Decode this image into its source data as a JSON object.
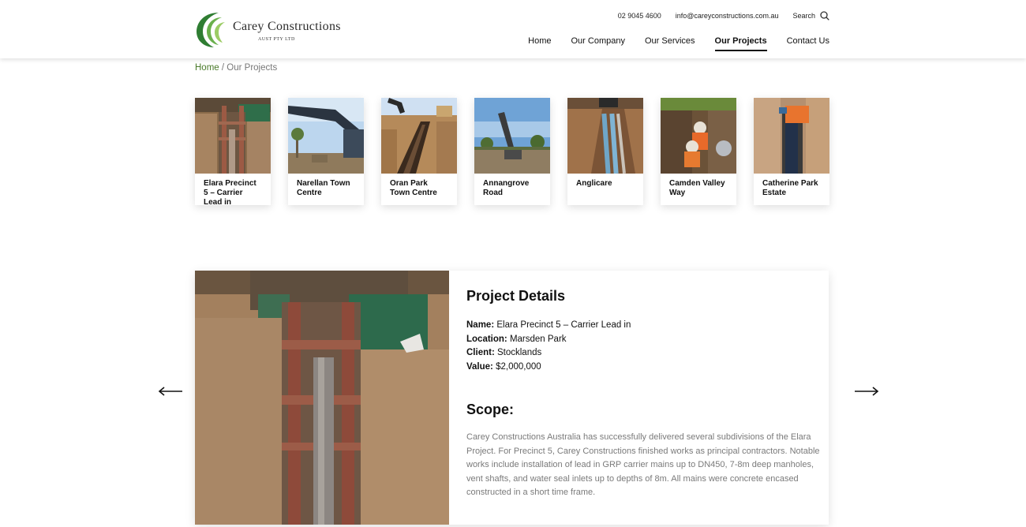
{
  "brand": {
    "name": "Carey Constructions",
    "subtitle": "AUST PTY LTD",
    "colors": {
      "green": "#2f7d32",
      "dark": "#2c2c2c",
      "accent_green": "#4a7a2a"
    }
  },
  "header": {
    "phone": "02 9045 4600",
    "email": "info@careyconstructions.com.au",
    "search_label": "Search",
    "search_icon": "search-icon",
    "nav": [
      {
        "label": "Home",
        "active": false
      },
      {
        "label": "Our Company",
        "active": false
      },
      {
        "label": "Our Services",
        "active": false
      },
      {
        "label": "Our Projects",
        "active": true
      },
      {
        "label": "Contact Us",
        "active": false
      }
    ]
  },
  "breadcrumb": {
    "home": "Home",
    "separator": " / ",
    "current": "Our Projects"
  },
  "projects": [
    {
      "label": "Elara Precinct 5 – Carrier Lead in"
    },
    {
      "label": "Narellan Town Centre"
    },
    {
      "label": "Oran Park Town Centre"
    },
    {
      "label": "Annangrove Road"
    },
    {
      "label": "Anglicare"
    },
    {
      "label": "Camden Valley Way"
    },
    {
      "label": "Catherine Park Estate"
    }
  ],
  "detail": {
    "title": "Project Details",
    "name_label": "Name:",
    "name_value": "Elara Precinct 5 – Carrier Lead in",
    "location_label": "Location:",
    "location_value": "Marsden Park",
    "client_label": "Client:",
    "client_value": "Stocklands",
    "value_label": "Value:",
    "value_value": "$2,000,000",
    "scope_title": "Scope:",
    "scope_text": "Carey Constructions Australia has successfully delivered several subdivisions of the Elara Project. For Precinct 5, Carey Constructions finished works as principal contractors. Notable works include installation of lead in GRP carrier mains up to DN450, 7-8m deep manholes, vent shafts, and water seal inlets up to depths of 8m. All mains were concrete encased constructed in a short time frame."
  },
  "carousel": {
    "prev_icon": "arrow-left-icon",
    "next_icon": "arrow-right-icon"
  }
}
